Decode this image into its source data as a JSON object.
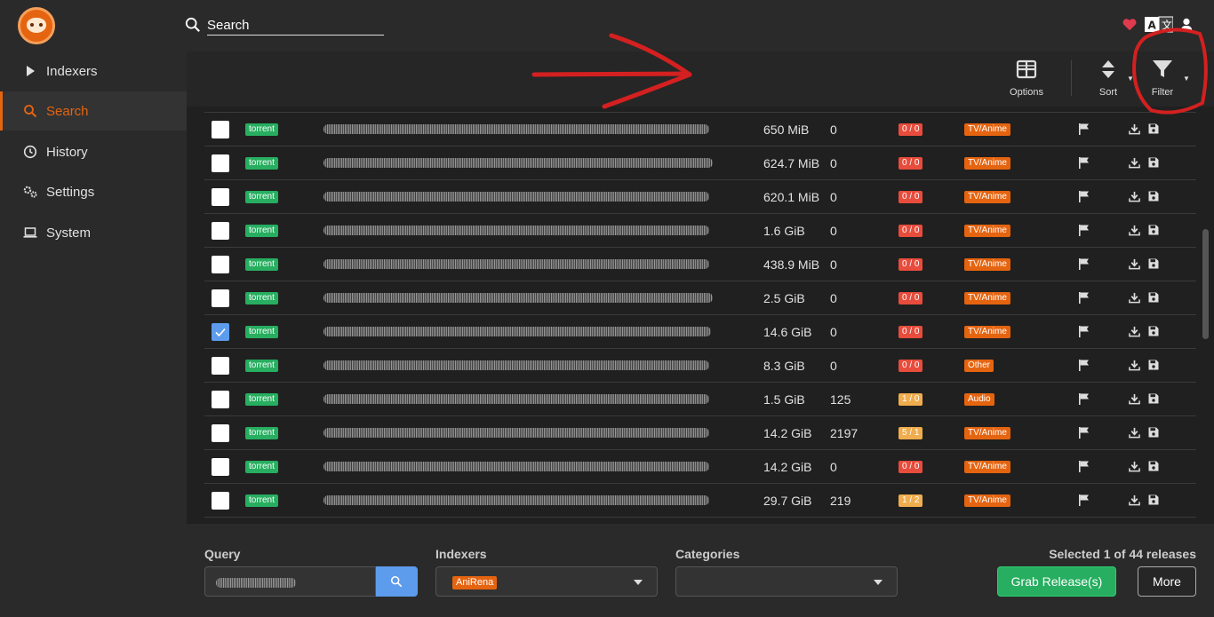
{
  "header": {
    "search_placeholder": "Search",
    "icons": [
      "logo",
      "search-icon",
      "heart-icon",
      "translate-icon",
      "user-icon"
    ]
  },
  "sidebar": {
    "items": [
      {
        "label": "Indexers",
        "icon": "play-icon",
        "active": false
      },
      {
        "label": "Search",
        "icon": "search-icon",
        "active": true
      },
      {
        "label": "History",
        "icon": "history-icon",
        "active": false
      },
      {
        "label": "Settings",
        "icon": "settings-icon",
        "active": false
      },
      {
        "label": "System",
        "icon": "laptop-icon",
        "active": false
      }
    ]
  },
  "toolbar": {
    "options_label": "Options",
    "sort_label": "Sort",
    "filter_label": "Filter"
  },
  "results": [
    {
      "protocol": "torrent",
      "size": "650 MiB",
      "grabs": "0",
      "peers": "0 / 0",
      "category": "TV/Anime",
      "checked": false
    },
    {
      "protocol": "torrent",
      "size": "624.7 MiB",
      "grabs": "0",
      "peers": "0 / 0",
      "category": "TV/Anime",
      "checked": false
    },
    {
      "protocol": "torrent",
      "size": "620.1 MiB",
      "grabs": "0",
      "peers": "0 / 0",
      "category": "TV/Anime",
      "checked": false
    },
    {
      "protocol": "torrent",
      "size": "1.6 GiB",
      "grabs": "0",
      "peers": "0 / 0",
      "category": "TV/Anime",
      "checked": false
    },
    {
      "protocol": "torrent",
      "size": "438.9 MiB",
      "grabs": "0",
      "peers": "0 / 0",
      "category": "TV/Anime",
      "checked": false
    },
    {
      "protocol": "torrent",
      "size": "2.5 GiB",
      "grabs": "0",
      "peers": "0 / 0",
      "category": "TV/Anime",
      "checked": false
    },
    {
      "protocol": "torrent",
      "size": "14.6 GiB",
      "grabs": "0",
      "peers": "0 / 0",
      "category": "TV/Anime",
      "checked": true
    },
    {
      "protocol": "torrent",
      "size": "8.3 GiB",
      "grabs": "0",
      "peers": "0 / 0",
      "category": "Other",
      "checked": false
    },
    {
      "protocol": "torrent",
      "size": "1.5 GiB",
      "grabs": "125",
      "peers": "1 / 0",
      "category": "Audio",
      "checked": false
    },
    {
      "protocol": "torrent",
      "size": "14.2 GiB",
      "grabs": "2197",
      "peers": "5 / 1",
      "category": "TV/Anime",
      "checked": false
    },
    {
      "protocol": "torrent",
      "size": "14.2 GiB",
      "grabs": "0",
      "peers": "0 / 0",
      "category": "TV/Anime",
      "checked": false
    },
    {
      "protocol": "torrent",
      "size": "29.7 GiB",
      "grabs": "219",
      "peers": "1 / 2",
      "category": "TV/Anime",
      "checked": false
    }
  ],
  "footer": {
    "query_label": "Query",
    "indexers_label": "Indexers",
    "indexers_selected": "AniRena",
    "categories_label": "Categories",
    "selection_status": "Selected 1 of 44 releases",
    "grab_label": "Grab Release(s)",
    "more_label": "More"
  },
  "colors": {
    "accent": "#e56410",
    "torrent_badge": "#27ae60",
    "peers_zero": "#e74c3c",
    "peers_active": "#f0ad4e",
    "checkbox_checked": "#5d9cec",
    "annotation": "#d42020"
  }
}
